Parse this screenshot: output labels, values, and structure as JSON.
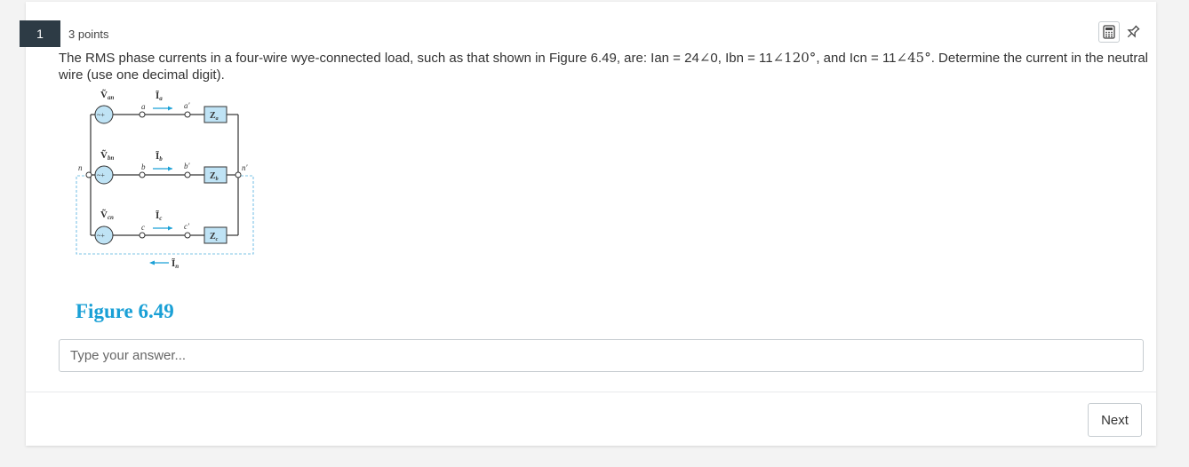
{
  "question": {
    "number": "1",
    "points": "3 points",
    "text_1": "The RMS  phase currents in a four-wire wye-connected load, such as that shown in Figure 6.49, are: Ian = 24",
    "angle_sym": "∠",
    "ian_angle": "0",
    "text_2": ", Ibn = 11",
    "ibn_angle": "120°",
    "text_3": ", and Icn = 11",
    "icn_angle": "45°",
    "text_4": ".  Determine the current in the neutral wire (use one decimal digit)."
  },
  "toolbar": {
    "calculator_icon": "calculator-icon",
    "pin_icon": "pin-icon"
  },
  "figure": {
    "caption": "Figure 6.49",
    "labels": {
      "v_an": "Ṽ",
      "v_an_sub": "an",
      "v_bn": "Ṽ",
      "v_bn_sub": "bn",
      "v_cn": "Ṽ",
      "v_cn_sub": "cn",
      "i_a": "Ĩ",
      "i_a_sub": "a",
      "i_b": "Ĩ",
      "i_b_sub": "b",
      "i_c": "Ĩ",
      "i_c_sub": "c",
      "i_n": "Ĩ",
      "i_n_sub": "n",
      "node_a": "a",
      "node_a2": "a′",
      "node_b": "b",
      "node_b2": "b′",
      "node_c": "c",
      "node_c2": "c′",
      "node_n": "n",
      "node_n2": "n′",
      "z_a": "Z",
      "z_a_sub": "a",
      "z_b": "Z",
      "z_b_sub": "b",
      "z_c": "Z",
      "z_c_sub": "c",
      "src_sign": "~+"
    },
    "colors": {
      "accent": "#1aa0d6",
      "source_fill": "#bfe3f5",
      "impedance_fill": "#bfe3f5",
      "wire": "#333333",
      "dashed": "#7ec4e6"
    }
  },
  "answer": {
    "placeholder": "Type your answer..."
  },
  "footer": {
    "next_label": "Next"
  }
}
